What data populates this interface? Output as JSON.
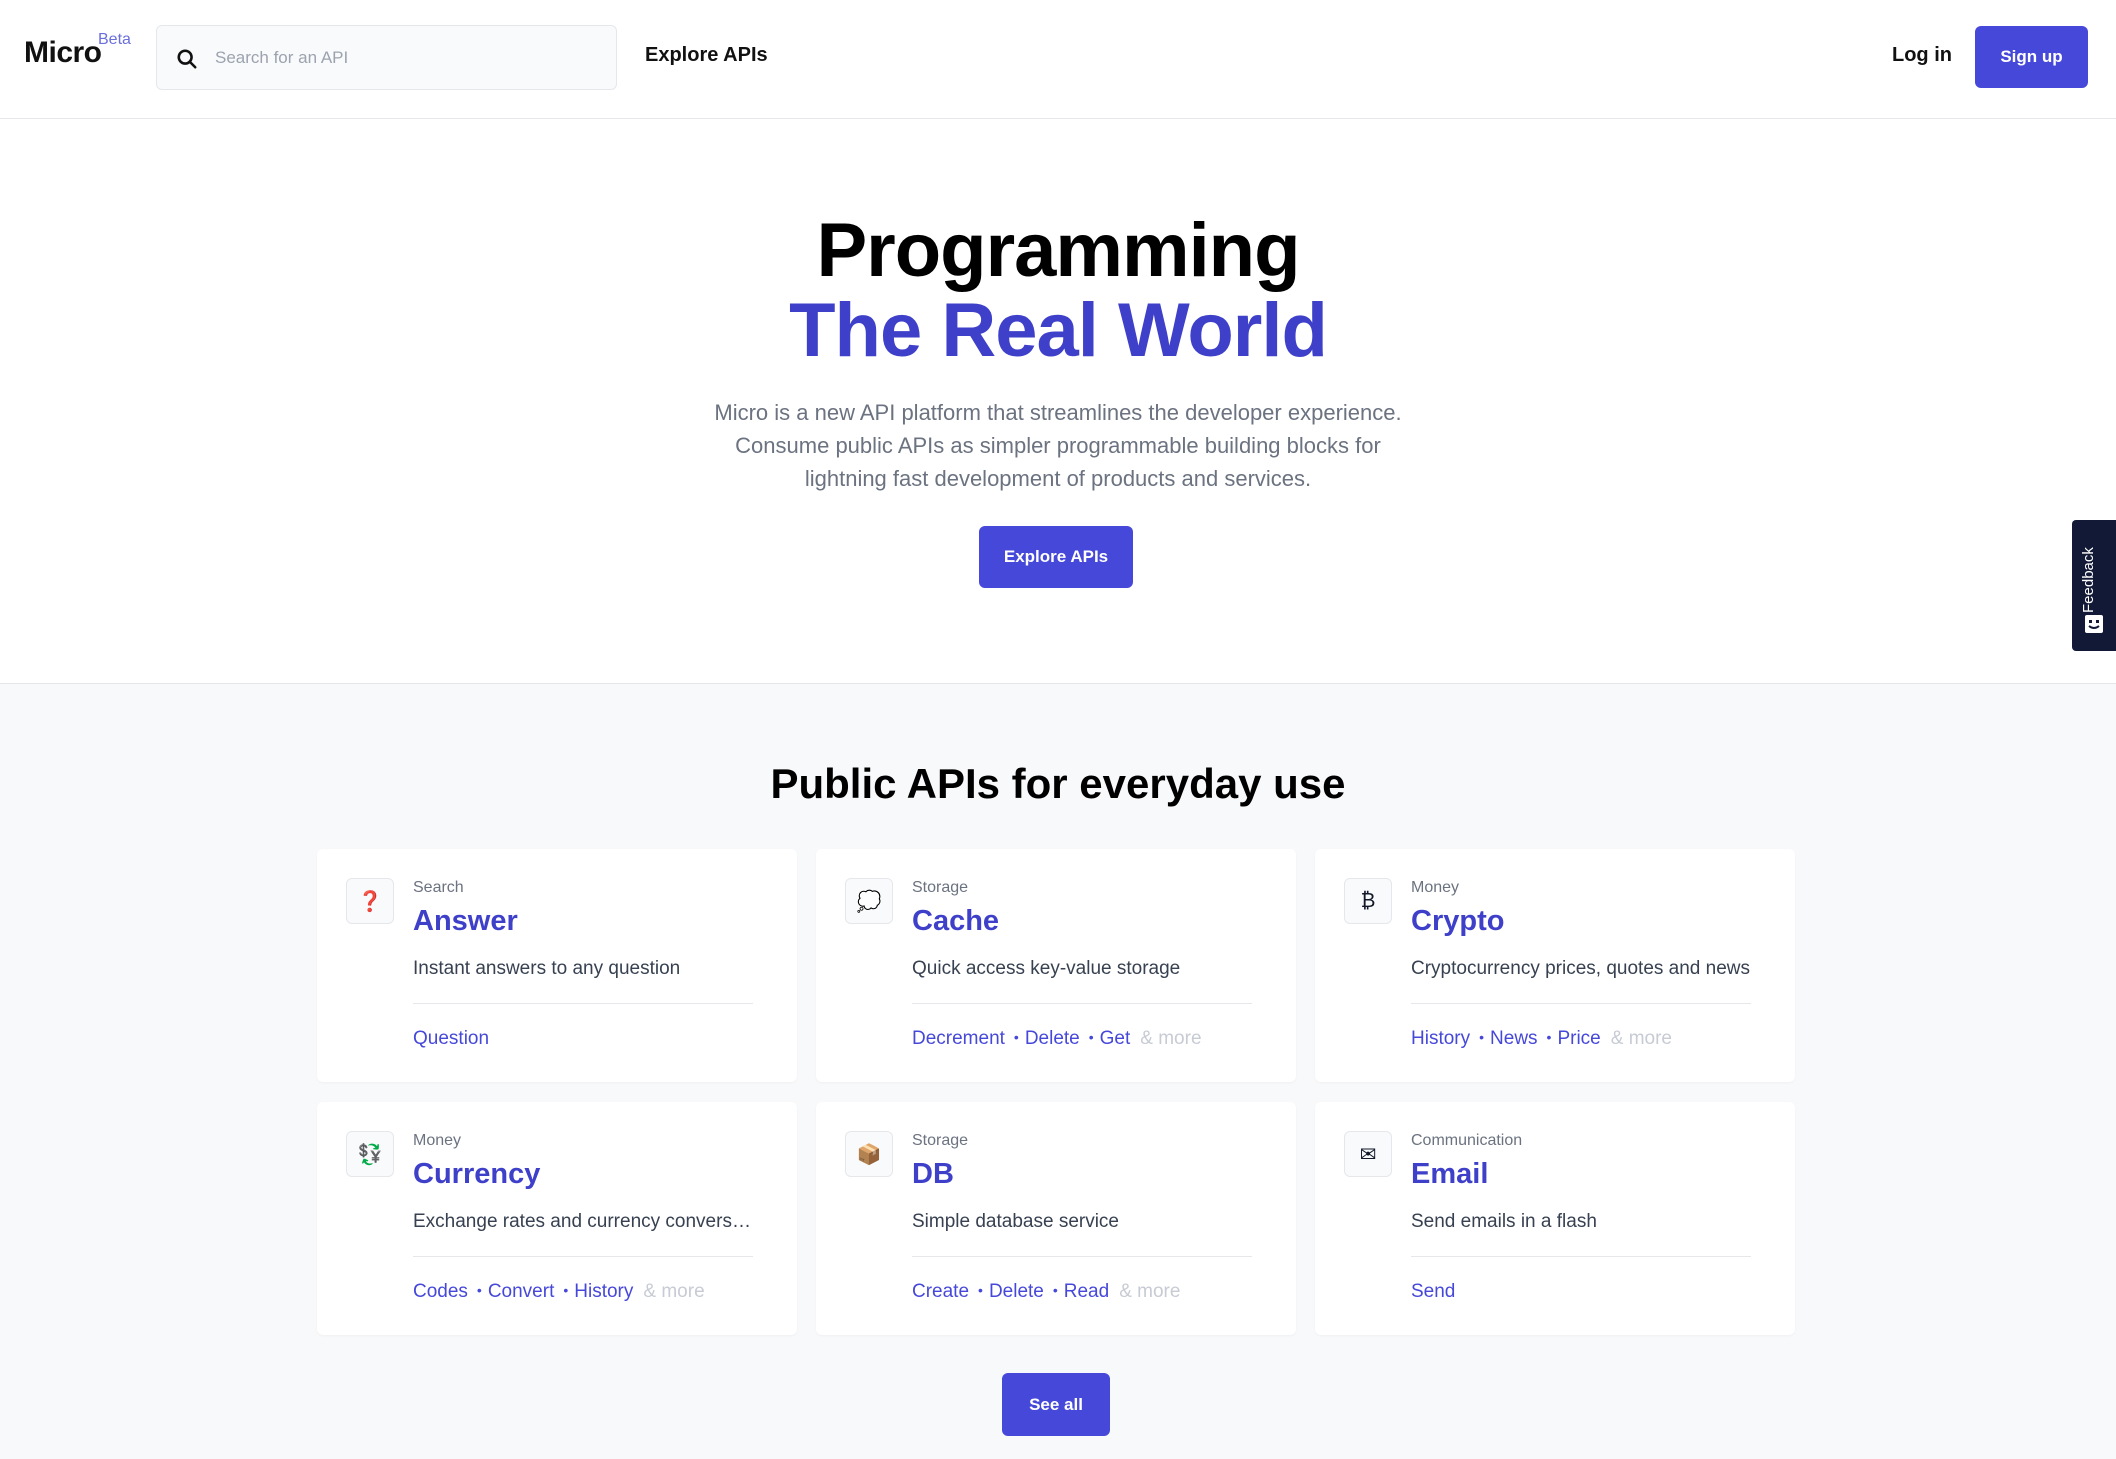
{
  "header": {
    "logo": "Micro",
    "logo_badge": "Beta",
    "search_placeholder": "Search for an API",
    "nav_explore": "Explore APIs",
    "login": "Log in",
    "signup": "Sign up"
  },
  "hero": {
    "title_line1": "Programming",
    "title_line2": "The Real World",
    "description": "Micro is a new API platform that streamlines the developer experience. Consume public APIs as simpler programmable building blocks for lightning fast development of products and services.",
    "cta": "Explore APIs"
  },
  "feedback": {
    "label": "Feedback"
  },
  "apis": {
    "heading": "Public APIs for everyday use",
    "more_label": "& more",
    "see_all": "See all",
    "cards": [
      {
        "icon": "question-mark-icon",
        "glyph": "❓",
        "category": "Search",
        "title": "Answer",
        "description": "Instant answers to any question",
        "endpoints": [
          "Question"
        ],
        "has_more": false
      },
      {
        "icon": "speech-bubble-icon",
        "glyph": "💭",
        "category": "Storage",
        "title": "Cache",
        "description": "Quick access key-value storage",
        "endpoints": [
          "Decrement",
          "Delete",
          "Get"
        ],
        "has_more": true
      },
      {
        "icon": "bitcoin-icon",
        "glyph": "₿",
        "category": "Money",
        "title": "Crypto",
        "description": "Cryptocurrency prices, quotes and news",
        "endpoints": [
          "History",
          "News",
          "Price"
        ],
        "has_more": true
      },
      {
        "icon": "currency-exchange-icon",
        "glyph": "💱",
        "category": "Money",
        "title": "Currency",
        "description": "Exchange rates and currency conversion",
        "endpoints": [
          "Codes",
          "Convert",
          "History"
        ],
        "has_more": true
      },
      {
        "icon": "package-icon",
        "glyph": "📦",
        "category": "Storage",
        "title": "DB",
        "description": "Simple database service",
        "endpoints": [
          "Create",
          "Delete",
          "Read"
        ],
        "has_more": true
      },
      {
        "icon": "envelope-icon",
        "glyph": "✉",
        "category": "Communication",
        "title": "Email",
        "description": "Send emails in a flash",
        "endpoints": [
          "Send"
        ],
        "has_more": false
      }
    ]
  }
}
